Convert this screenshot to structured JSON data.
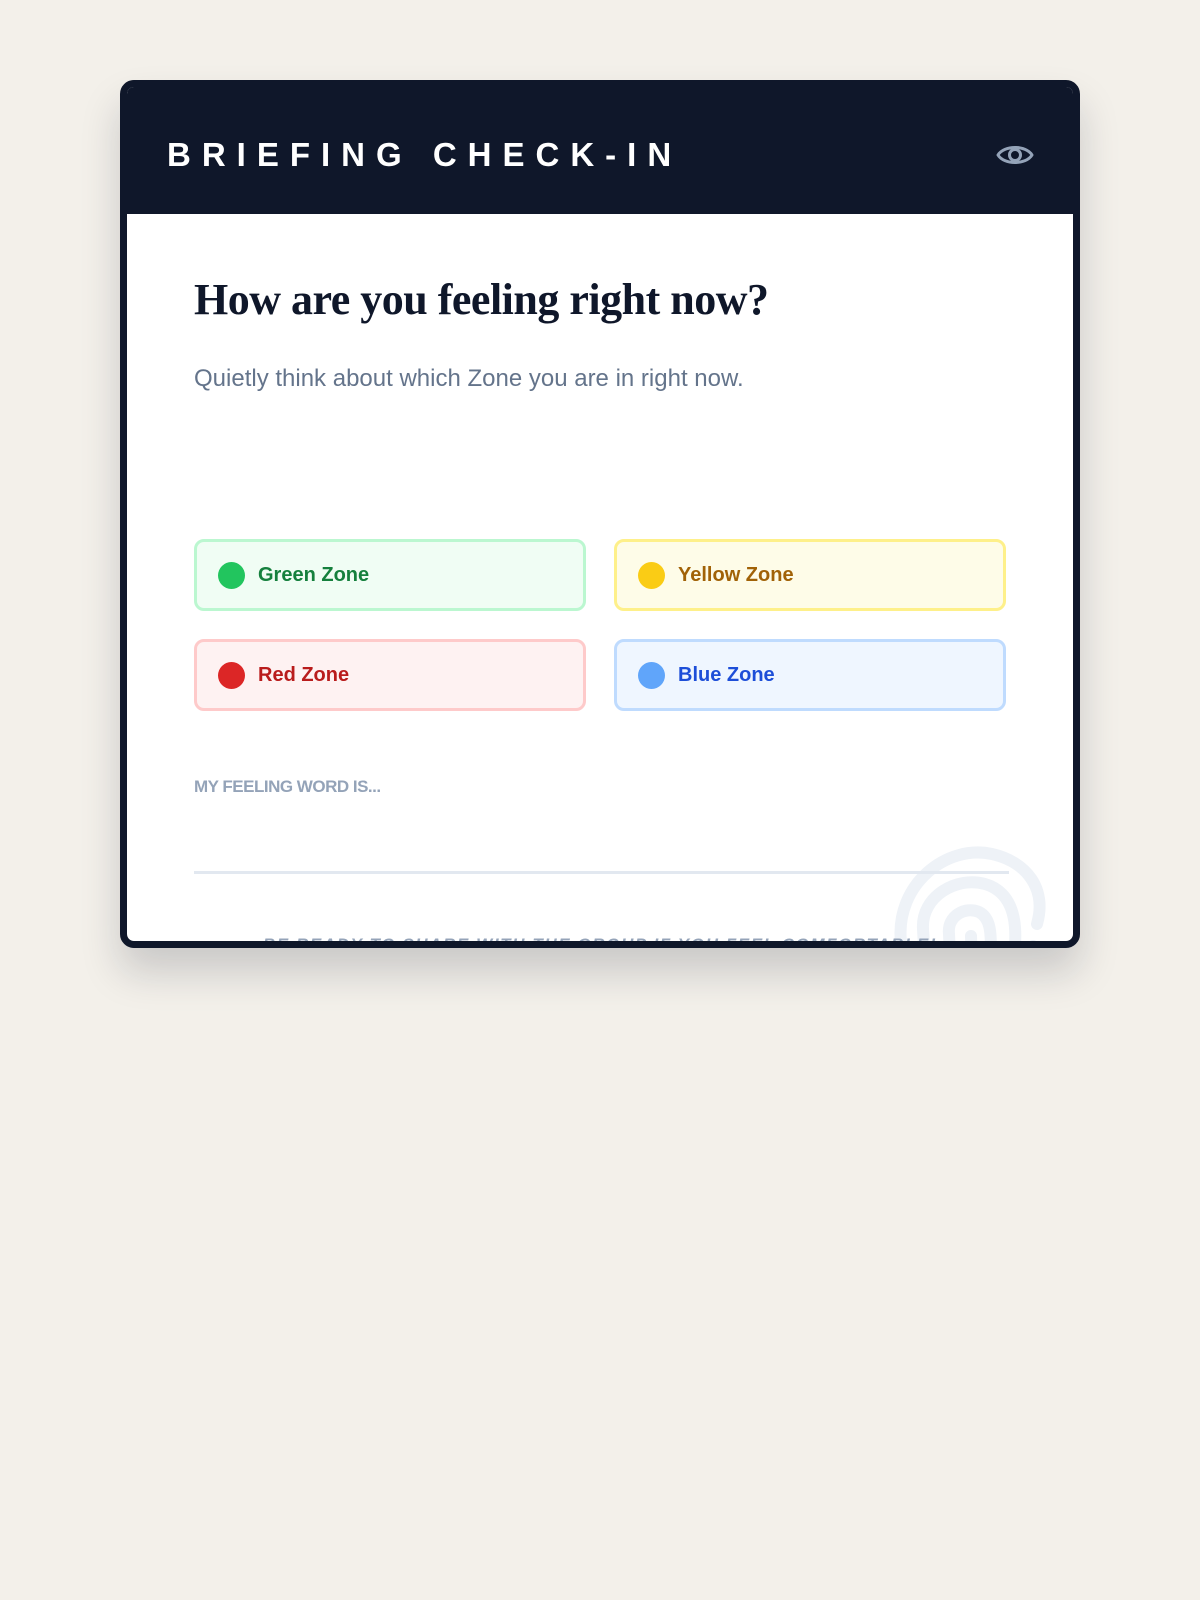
{
  "header": {
    "title": "BRIEFING CHECK-IN",
    "icon": "eye-icon"
  },
  "prompt": {
    "question": "How are you feeling right now?",
    "instruction": "Quietly think about which Zone you are in right now."
  },
  "zones": [
    {
      "label": "Green Zone",
      "color": "#22c55e"
    },
    {
      "label": "Yellow Zone",
      "color": "#facc15"
    },
    {
      "label": "Red Zone",
      "color": "#dc2626"
    },
    {
      "label": "Blue Zone",
      "color": "#60a5fa"
    }
  ],
  "feeling": {
    "label": "MY FEELING WORD IS...",
    "value": "",
    "placeholder": ""
  },
  "footer": {
    "note": "BE READY TO SHARE WITH THE GROUP IF YOU FEEL COMFORTABLE!",
    "decoration_icon": "fingerprint-icon"
  },
  "colors": {
    "header_bg": "#0f172a",
    "page_bg": "#f3f0ea"
  }
}
